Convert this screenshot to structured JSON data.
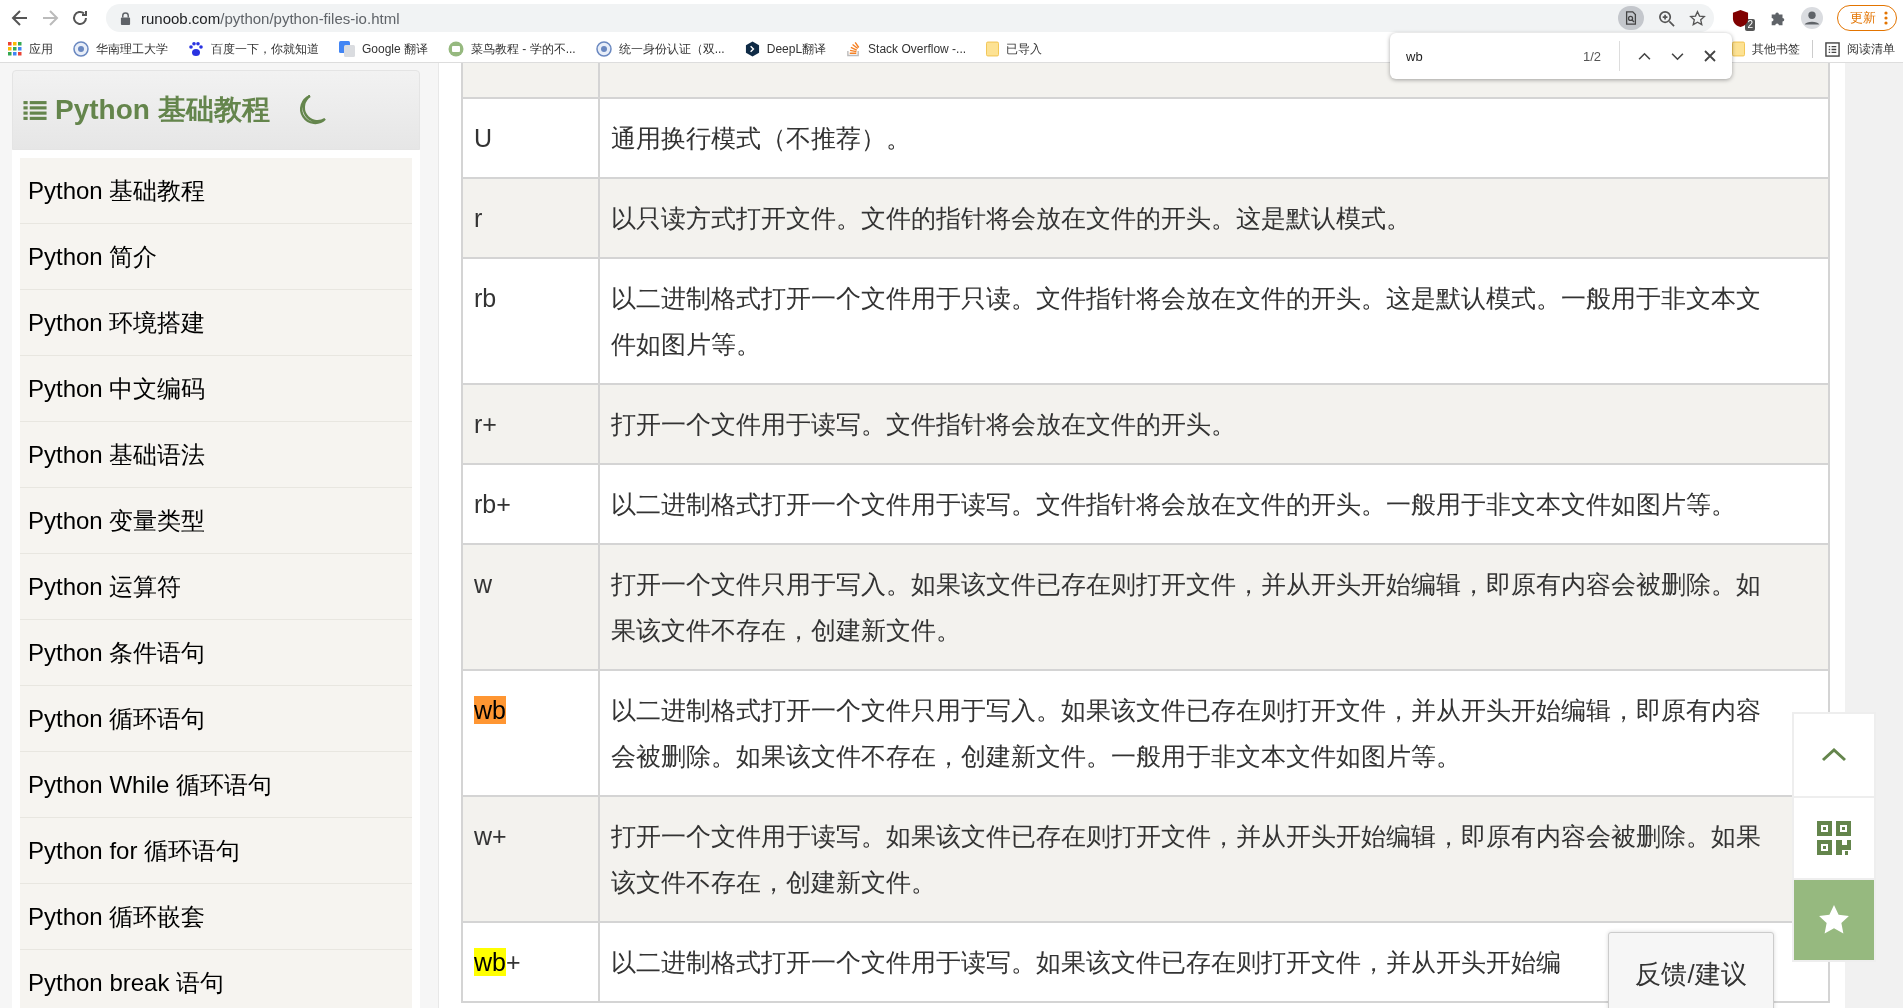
{
  "browser": {
    "url_host": "runoob.com",
    "url_path": "/python/python-files-io.html",
    "back_disabled": false,
    "forward_disabled": true,
    "update_label": "更新",
    "extension_badge": "2",
    "bookmarks": [
      {
        "label": "应用"
      },
      {
        "label": "华南理工大学"
      },
      {
        "label": "百度一下，你就知道"
      },
      {
        "label": "Google 翻译"
      },
      {
        "label": "菜鸟教程 - 学的不..."
      },
      {
        "label": "统一身份认证（双..."
      },
      {
        "label": "DeepL翻译"
      },
      {
        "label": "Stack Overflow -..."
      },
      {
        "label": "已导入"
      }
    ],
    "bookmarks_right": [
      {
        "label": "其他书签"
      },
      {
        "label": "阅读清单"
      }
    ]
  },
  "find_bar": {
    "query": "wb",
    "count": "1/2"
  },
  "sidebar": {
    "title": "Python 基础教程",
    "items": [
      {
        "label": "Python 基础教程"
      },
      {
        "label": "Python 简介"
      },
      {
        "label": "Python 环境搭建"
      },
      {
        "label": "Python 中文编码"
      },
      {
        "label": "Python 基础语法"
      },
      {
        "label": "Python 变量类型"
      },
      {
        "label": "Python 运算符"
      },
      {
        "label": "Python 条件语句"
      },
      {
        "label": "Python 循环语句"
      },
      {
        "label": "Python While 循环语句"
      },
      {
        "label": "Python for 循环语句"
      },
      {
        "label": "Python 循环嵌套"
      },
      {
        "label": "Python break 语句"
      }
    ]
  },
  "table": {
    "rows": [
      {
        "mode": [
          {
            "text": "U"
          }
        ],
        "description": "通用换行模式（不推荐）。"
      },
      {
        "mode": [
          {
            "text": "r"
          }
        ],
        "description": "以只读方式打开文件。文件的指针将会放在文件的开头。这是默认模式。"
      },
      {
        "mode": [
          {
            "text": "rb"
          }
        ],
        "description": "以二进制格式打开一个文件用于只读。文件指针将会放在文件的开头。这是默认模式。一般用于非文本文件如图片等。"
      },
      {
        "mode": [
          {
            "text": "r+"
          }
        ],
        "description": "打开一个文件用于读写。文件指针将会放在文件的开头。"
      },
      {
        "mode": [
          {
            "text": "rb+"
          }
        ],
        "description": "以二进制格式打开一个文件用于读写。文件指针将会放在文件的开头。一般用于非文本文件如图片等。"
      },
      {
        "mode": [
          {
            "text": "w"
          }
        ],
        "description": "打开一个文件只用于写入。如果该文件已存在则打开文件，并从开头开始编辑，即原有内容会被删除。如果该文件不存在，创建新文件。"
      },
      {
        "mode": [
          {
            "text": "wb",
            "match": true,
            "current": true
          }
        ],
        "description": "以二进制格式打开一个文件只用于写入。如果该文件已存在则打开文件，并从开头开始编辑，即原有内容会被删除。如果该文件不存在，创建新文件。一般用于非文本文件如图片等。"
      },
      {
        "mode": [
          {
            "text": "w+"
          }
        ],
        "description": "打开一个文件用于读写。如果该文件已存在则打开文件，并从开头开始编辑，即原有内容会被删除。如果该文件不存在，创建新文件。"
      },
      {
        "mode": [
          {
            "text": "wb",
            "match": true,
            "current": false
          },
          {
            "text": "+",
            "match": false
          }
        ],
        "description": "以二进制格式打开一个文件用于读写。如果该文件已存在则打开文件，并从开头开始编"
      }
    ]
  },
  "feedback_label": "反馈/建议"
}
